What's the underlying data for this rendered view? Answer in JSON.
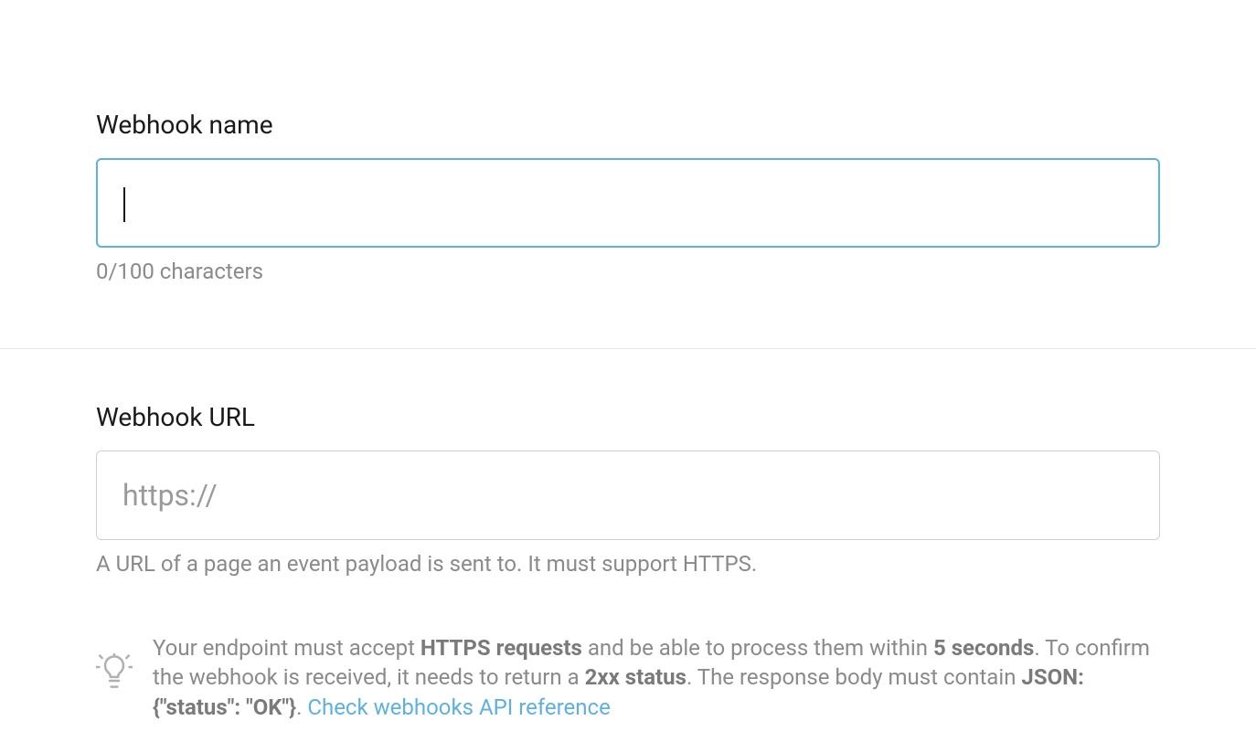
{
  "webhook_name": {
    "label": "Webhook name",
    "value": "",
    "counter": "0/100 characters"
  },
  "webhook_url": {
    "label": "Webhook URL",
    "placeholder": "https://",
    "value": "",
    "helper": "A URL of a page an event payload is sent to. It must support HTTPS."
  },
  "info": {
    "part1": "Your endpoint must accept ",
    "bold1": "HTTPS requests",
    "part2": " and be able to process them within ",
    "bold2": "5 seconds",
    "part3": ". To confirm the webhook is received, it needs to return a ",
    "bold3": "2xx status",
    "part4": ". The response body must contain ",
    "bold4": "JSON: {\"status\": \"OK\"}",
    "part5": ". ",
    "link": "Check webhooks API reference"
  }
}
